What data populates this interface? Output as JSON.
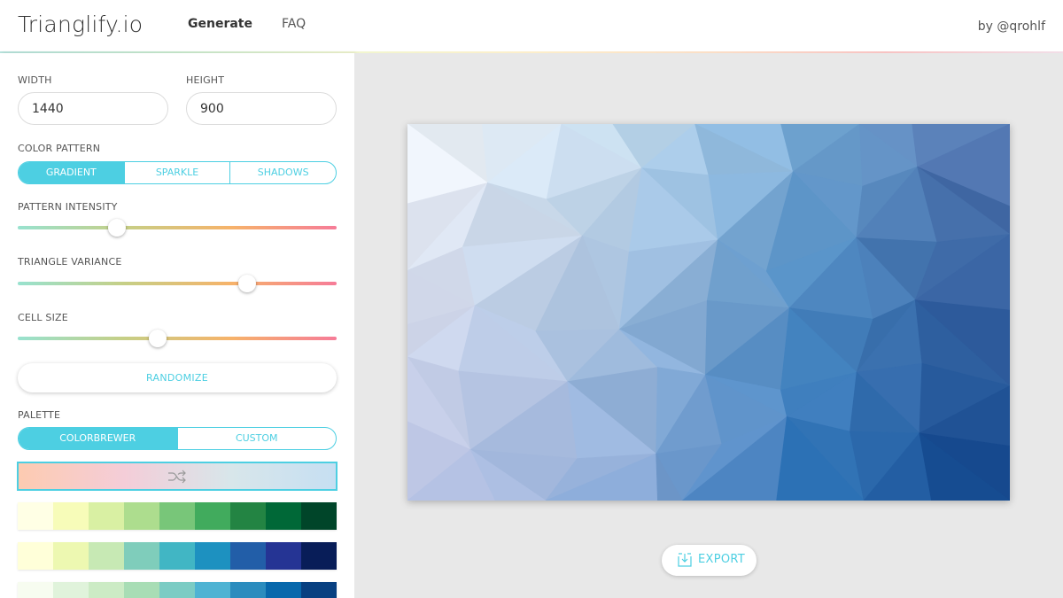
{
  "header": {
    "logo": "Trianglify.io",
    "nav": [
      {
        "label": "Generate",
        "active": true
      },
      {
        "label": "FAQ",
        "active": false
      }
    ],
    "byline": "by @qrohlf"
  },
  "sidebar": {
    "width": {
      "label": "WIDTH",
      "value": "1440"
    },
    "height": {
      "label": "HEIGHT",
      "value": "900"
    },
    "color_pattern": {
      "label": "COLOR PATTERN",
      "options": [
        "GRADIENT",
        "SPARKLE",
        "SHADOWS"
      ],
      "selected": "GRADIENT"
    },
    "pattern_intensity": {
      "label": "PATTERN INTENSITY",
      "value_fraction": 0.31
    },
    "triangle_variance": {
      "label": "TRIANGLE VARIANCE",
      "value_fraction": 0.72
    },
    "cell_size": {
      "label": "CELL SIZE",
      "value_fraction": 0.44
    },
    "randomize_label": "RANDOMIZE",
    "palette": {
      "label": "PALETTE",
      "options": [
        "COLORBREWER",
        "CUSTOM"
      ],
      "selected": "COLORBREWER",
      "shuffle_icon": "shuffle-icon",
      "swatch_rows": [
        [
          "#ffffe5",
          "#f7fcb9",
          "#d9f0a3",
          "#addd8e",
          "#78c679",
          "#41ab5d",
          "#238443",
          "#006837",
          "#004529"
        ],
        [
          "#ffffd9",
          "#edf8b1",
          "#c7e9b4",
          "#7fcdbb",
          "#41b6c4",
          "#1d91c0",
          "#225ea8",
          "#253494",
          "#081d58"
        ],
        [
          "#f7fcf0",
          "#e0f3db",
          "#ccebc5",
          "#a8ddb5",
          "#7bccc4",
          "#4eb3d3",
          "#2b8cbe",
          "#0868ac",
          "#084081"
        ]
      ]
    }
  },
  "main": {
    "export_label": "EXPORT",
    "export_icon": "download-icon"
  },
  "colors": {
    "accent": "#4dcfe2"
  }
}
